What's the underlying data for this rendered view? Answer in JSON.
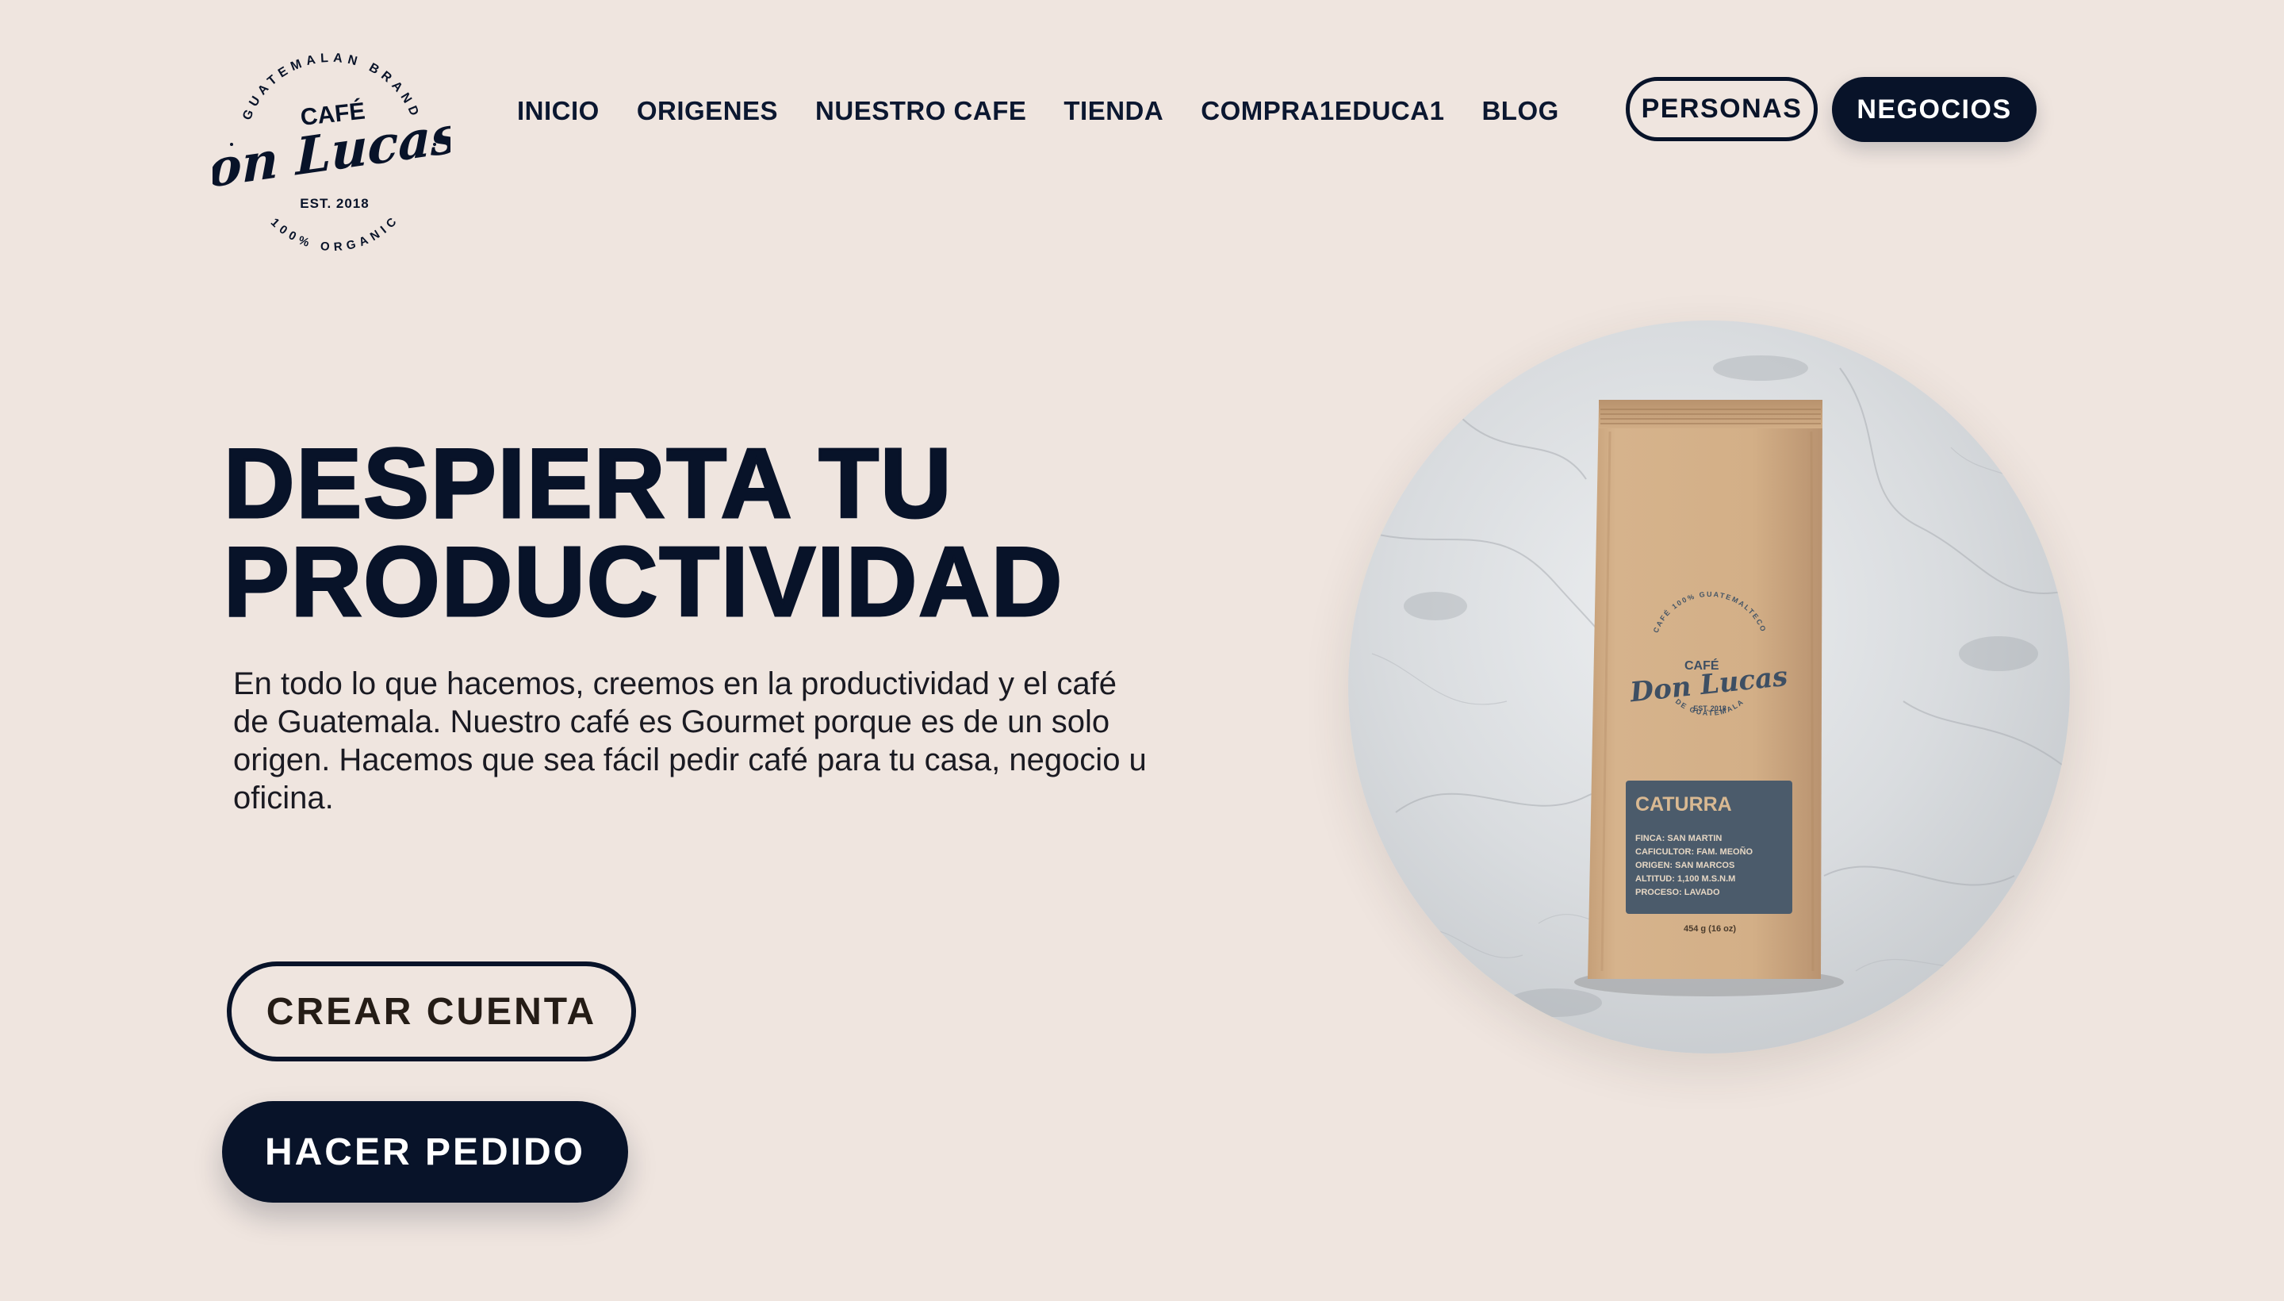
{
  "logo": {
    "top_arc": "GUATEMALAN BRAND",
    "bottom_arc": "100% ORGANIC",
    "cafe": "CAFÉ",
    "name": "Don Lucas",
    "est": "EST. 2018"
  },
  "nav": {
    "items": [
      "INICIO",
      "ORIGENES",
      "NUESTRO CAFE",
      "TIENDA",
      "COMPRA1EDUCA1",
      "BLOG"
    ],
    "personas_label": "PERSONAS",
    "negocios_label": "NEGOCIOS"
  },
  "hero": {
    "title_line1": "DESPIERTA TU",
    "title_line2": "PRODUCTIVIDAD",
    "description": "En todo lo que hacemos, creemos en la productividad y el café de Guatemala. Nuestro café es Gourmet porque es de un solo origen. Hacemos que sea fácil pedir café para tu casa, negocio u oficina.",
    "create_account_label": "CREAR CUENTA",
    "order_label": "HACER PEDIDO"
  },
  "product": {
    "bag_logo_cafe": "CAFÉ",
    "bag_logo_name": "Don Lucas",
    "bag_logo_est": "EST. 2018",
    "bag_logo_top_arc": "CAFÉ 100% GUATEMALTECO",
    "bag_logo_bottom_arc": "DE GUATEMALA",
    "variety": "CATURRA",
    "details": [
      "FINCA: SAN MARTIN",
      "CAFICULTOR: FAM. MEOÑO",
      "ORIGEN: SAN MARCOS",
      "ALTITUD: 1,100 M.S.N.M",
      "PROCESO: LAVADO"
    ],
    "weight": "454 g (16 oz)"
  },
  "colors": {
    "background": "#efe5df",
    "navy": "#081329",
    "kraft": "#d1ad86",
    "label_panel": "#4b5b6b"
  }
}
